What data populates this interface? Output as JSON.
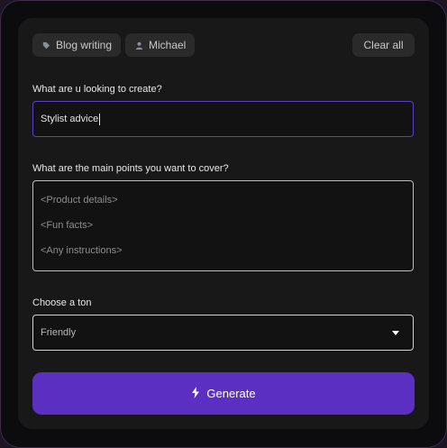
{
  "tags": [
    {
      "label": "Blog writing",
      "icon": "tag-icon"
    },
    {
      "label": "Michael",
      "icon": "user-icon"
    }
  ],
  "clear_all_label": "Clear all",
  "create_field": {
    "label": "What are u looking to create?",
    "value": "Stylist advice"
  },
  "points_field": {
    "label": "What are the main points you want to cover?",
    "placeholder_lines": [
      "<Product details>",
      "<Fun facts>",
      "<Any instructions>"
    ]
  },
  "tone_field": {
    "label": "Choose a ton",
    "selected": "Friendly"
  },
  "generate_label": "Generate",
  "colors": {
    "accent": "#5a2fc2",
    "focus_border": "#5b3fc4",
    "panel": "#181818"
  }
}
